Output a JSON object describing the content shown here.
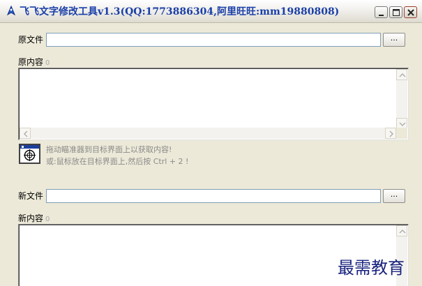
{
  "window": {
    "title": "飞飞文字修改工具v1.3(QQ:1773886304,阿里旺旺:mm19880808)"
  },
  "original_file": {
    "label": "原文件",
    "value": "",
    "browse_label": "..."
  },
  "original_content": {
    "label": "原内容",
    "count": "0",
    "value": ""
  },
  "targeter": {
    "hint_line1": "拖动瞄准器到目标界面上以获取内容!",
    "hint_line2": "或:鼠标放在目标界面上,然后按 Ctrl + 2 !"
  },
  "new_file": {
    "label": "新文件",
    "value": "",
    "browse_label": "..."
  },
  "new_content": {
    "label": "新内容",
    "count": "0",
    "value": ""
  },
  "watermark": "最需教育",
  "colors": {
    "title_text": "#1a3fa8",
    "window_bg": "#ece9d8",
    "hint_text": "#8a8a8a",
    "watermark": "#1a237e"
  }
}
